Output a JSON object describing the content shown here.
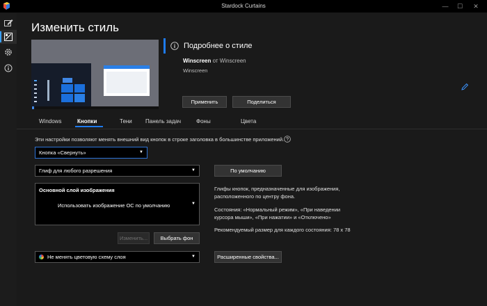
{
  "window": {
    "title": "Stardock Curtains",
    "minimize_glyph": "—",
    "maximize_glyph": "☐",
    "close_glyph": "✕"
  },
  "sidebar": {
    "items": [
      {
        "icon": "edit-style-icon",
        "active": false
      },
      {
        "icon": "style-gallery-icon",
        "active": true
      },
      {
        "icon": "settings-gear-icon",
        "active": false
      },
      {
        "icon": "info-icon",
        "active": false
      }
    ]
  },
  "page": {
    "title": "Изменить стиль"
  },
  "style_info": {
    "header": "Подробнее о стиле",
    "name": "Winscreen",
    "author_prefix": "от",
    "author": "Winscreen",
    "subtitle": "Winscreen",
    "apply_label": "Применить",
    "share_label": "Поделиться"
  },
  "tabs": [
    {
      "label": "Windows",
      "active": false
    },
    {
      "label": "Кнопки",
      "active": true
    },
    {
      "label": "Тени",
      "active": false
    },
    {
      "label": "Панель задач",
      "active": false
    },
    {
      "label": "Фоны",
      "active": false
    },
    {
      "label": "Цвета",
      "active": false
    }
  ],
  "buttons_tab": {
    "description": "Эти настройки позволяют менять внешний вид кнопок в строке заголовка в большинстве приложений.",
    "button_select": "Кнопка «Свернуть»",
    "glyph_select": "Глиф для любого разрешения",
    "default_label": "По умолчанию",
    "layer_title": "Основной слой изображения",
    "layer_value": "Использовать изображение ОС по умолчанию",
    "change_label": "Изменить...",
    "choose_bg_label": "Выбрать фон",
    "color_select": "Не менять цветовую схему слоя",
    "advanced_label": "Расширенные свойства...",
    "info_line1": "Глифы кнопок, предназначенные для изображения,",
    "info_line2": "расположенного по центру фона.",
    "info_line3": "Состояния: «Нормальный режим», «При наведении",
    "info_line4": "курсора мыши», «При нажатии» и «Отключено»",
    "info_line5": "Рекомендуемый размер для каждого состояния: 78 x 78"
  },
  "colors": {
    "accent": "#1e7bef",
    "background": "#1a1a1a",
    "sidebar": "#1c1c1c",
    "button": "#333333"
  }
}
